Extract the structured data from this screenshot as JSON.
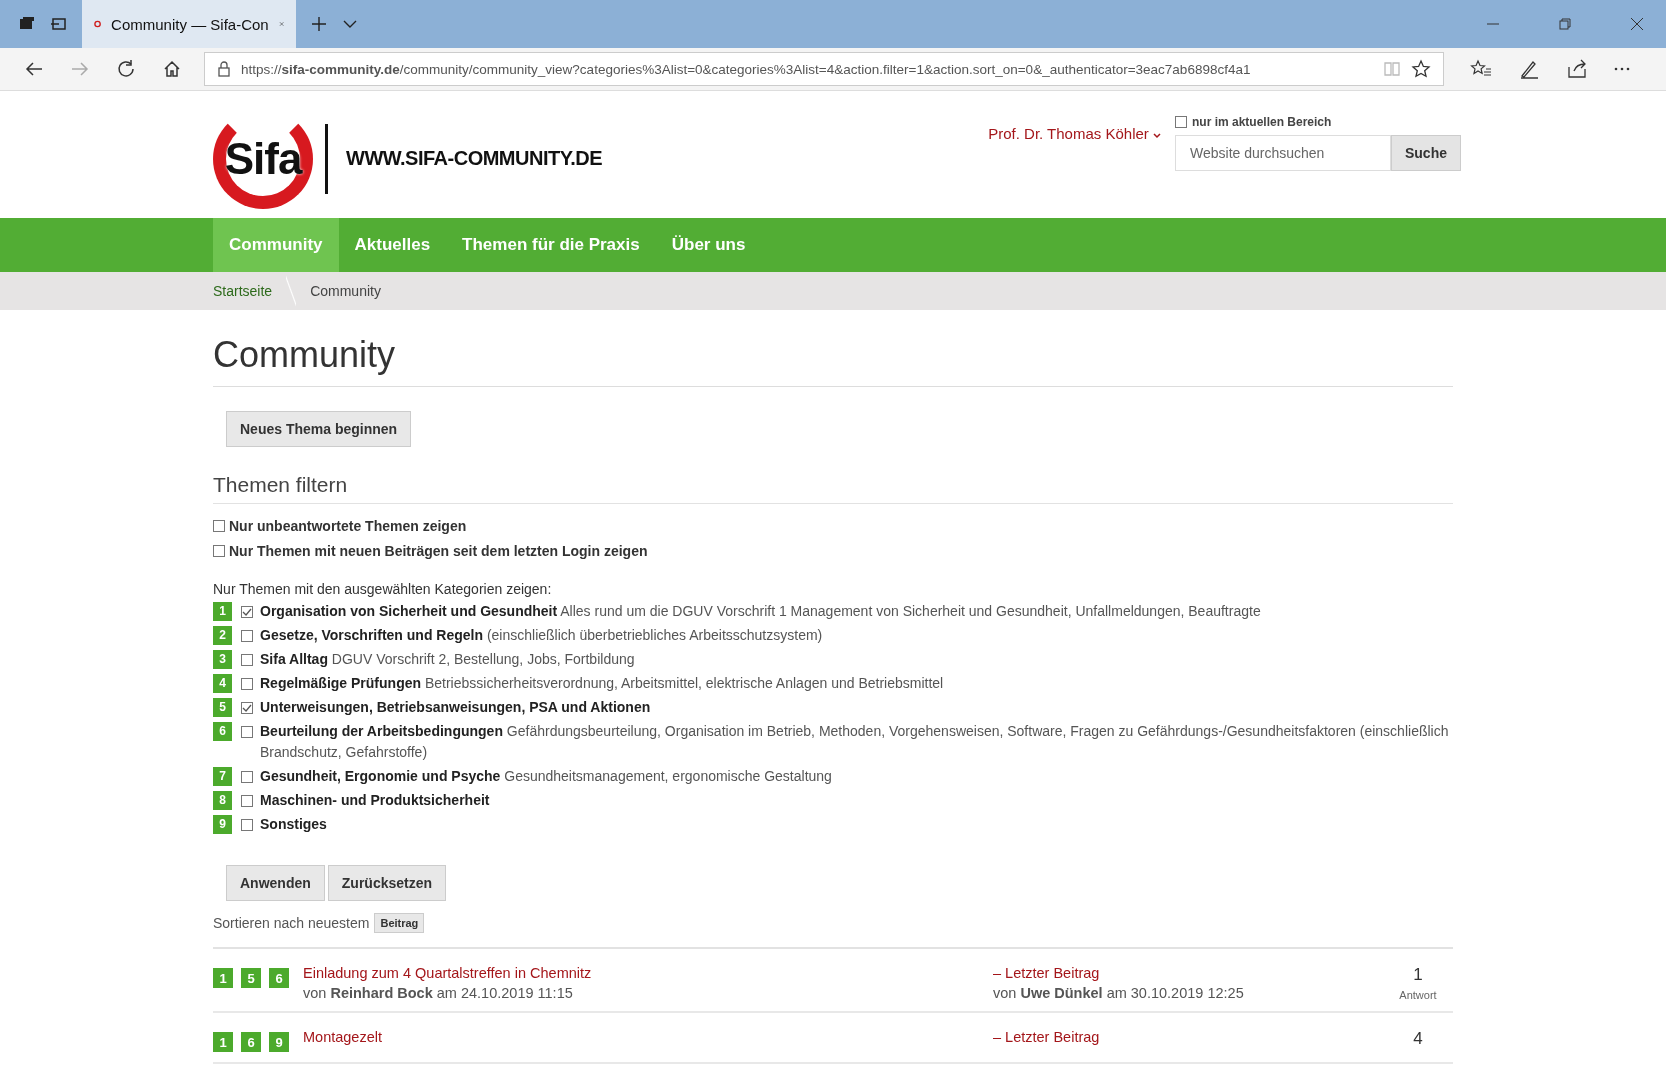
{
  "browser": {
    "tab_title": "Community — Sifa-Con",
    "url": "https://**sifa-community.de**/community/community_view?categories%3Alist=0&categories%3Alist=4&action.filter=1&action.sort_on=0&_authenticator=3eac7ab6898cf4a1"
  },
  "header": {
    "logo_text": "Sifa",
    "site_name": "WWW.SIFA-COMMUNITY.DE",
    "user": "Prof. Dr. Thomas Köhler",
    "scope_option": {
      "label": "nur im aktuellen Bereich",
      "checked": false
    },
    "search": {
      "placeholder": "Website durchsuchen",
      "button": "Suche"
    }
  },
  "nav": [
    {
      "label": "Community",
      "selected": true
    },
    {
      "label": "Aktuelles",
      "selected": false
    },
    {
      "label": "Themen für die Praxis",
      "selected": false
    },
    {
      "label": "Über uns",
      "selected": false
    }
  ],
  "breadcrumb": [
    "Startseite",
    "Community"
  ],
  "title": "Community",
  "new_topic_button": "Neues Thema beginnen",
  "filter": {
    "heading": "Themen filtern",
    "options": [
      {
        "label": "Nur unbeantwortete Themen zeigen",
        "checked": false
      },
      {
        "label": "Nur Themen mit neuen Beiträgen seit dem letzten Login zeigen",
        "checked": false
      }
    ],
    "categories_label": "Nur Themen mit den ausgewählten Kategorien zeigen:",
    "categories": [
      {
        "number": "1",
        "name": "Organisation von Sicherheit und Gesundheit",
        "description": "Alles rund um die DGUV Vorschrift 1 Management von Sicherheit und Gesundheit, Unfallmeldungen, Beauftragte",
        "checked": true
      },
      {
        "number": "2",
        "name": "Gesetze, Vorschriften und Regeln",
        "description": "(einschließlich überbetriebliches Arbeitsschutzsystem)",
        "checked": false
      },
      {
        "number": "3",
        "name": "Sifa Alltag",
        "description": "DGUV Vorschrift 2, Bestellung, Jobs, Fortbildung",
        "checked": false
      },
      {
        "number": "4",
        "name": "Regelmäßige Prüfungen",
        "description": "Betriebssicherheitsverordnung, Arbeitsmittel, elektrische Anlagen und Betriebsmittel",
        "checked": false
      },
      {
        "number": "5",
        "name": "Unterweisungen, Betriebsanweisungen, PSA und Aktionen",
        "checked": true
      },
      {
        "number": "6",
        "name": "Beurteilung der Arbeitsbedingungen",
        "description": "Gefährdungsbeurteilung, Organisation im Betrieb, Methoden, Vorgehensweisen, Software, Fragen zu Gefährdungs-/Gesundheitsfaktoren (einschließlich Brandschutz, Gefahrstoffe)",
        "checked": false
      },
      {
        "number": "7",
        "name": "Gesundheit, Ergonomie und Psyche",
        "description": "Gesundheitsmanagement, ergonomische Gestaltung",
        "checked": false
      },
      {
        "number": "8",
        "name": "Maschinen- und Produktsicherheit",
        "checked": false
      },
      {
        "number": "9",
        "name": "Sonstiges",
        "checked": false
      }
    ],
    "buttons": [
      "Anwenden",
      "Zurücksetzen"
    ]
  },
  "sort": {
    "label": "Sortieren nach neuestem",
    "button": "Beitrag"
  },
  "topics": [
    {
      "tags": [
        "1",
        "5",
        "6"
      ],
      "title": "Einladung zum 4 Quartalstreffen in Chemnitz",
      "byline": "von **Reinhard Bock** am 24.10.2019 11:15",
      "last_label": "– Letzter Beitrag",
      "last_byline": "von **Uwe Dünkel** am 30.10.2019 12:25",
      "count": "1",
      "count_label": "Antwort"
    },
    {
      "tags": [
        "1",
        "6",
        "9"
      ],
      "title": "Montagezelt",
      "last_label": "– Letzter Beitrag",
      "count": "4"
    }
  ]
}
